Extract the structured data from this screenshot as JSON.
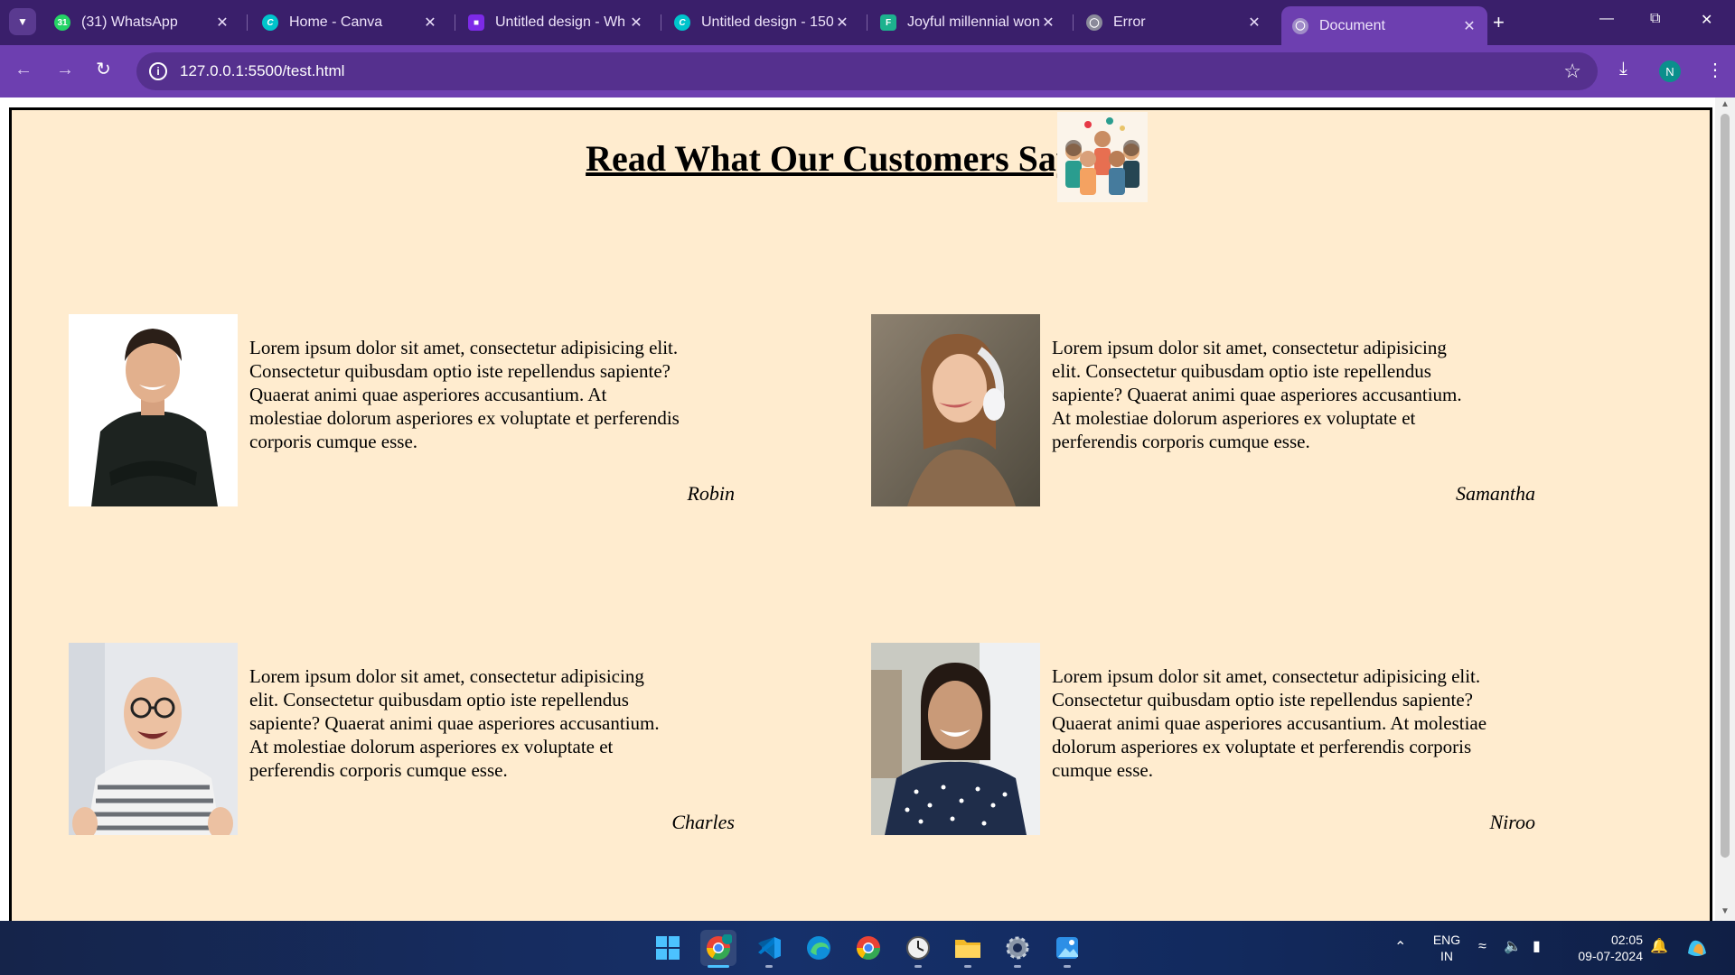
{
  "browser": {
    "tabs": [
      {
        "title": "(31) WhatsApp",
        "icon": "whatsapp-icon",
        "color": "#25d366"
      },
      {
        "title": "Home - Canva",
        "icon": "canva-icon",
        "color": "#00c4cc"
      },
      {
        "title": "Untitled design - Wh",
        "icon": "canva-design-icon",
        "color": "#7d2ae8"
      },
      {
        "title": "Untitled design - 150",
        "icon": "canva-icon",
        "color": "#00c4cc"
      },
      {
        "title": "Joyful millennial won",
        "icon": "freepik-icon",
        "color": "#1db28e"
      },
      {
        "title": "Error",
        "icon": "globe-icon",
        "color": "#8a8a9a"
      },
      {
        "title": "Document",
        "icon": "globe-icon",
        "color": "#a08cc8"
      }
    ],
    "active_tab_index": 6,
    "address": "127.0.0.1:5500/test.html",
    "profile_initial": "N",
    "accent": "#6d3fb0"
  },
  "page": {
    "heading": "Read What Our Customers Say",
    "testimonials": [
      {
        "name": "Robin",
        "text": "Lorem ipsum dolor sit amet, consectetur adipisicing elit. Consectetur quibusdam optio iste repellendus sapiente? Quaerat animi quae asperiores accusantium. At molestiae dolorum asperiores ex voluptate et perferendis corporis cumque esse."
      },
      {
        "name": "Samantha",
        "text": "Lorem ipsum dolor sit amet, consectetur adipisicing elit. Consectetur quibusdam optio iste repellendus sapiente? Quaerat animi quae asperiores accusantium. At molestiae dolorum asperiores ex voluptate et perferendis corporis cumque esse."
      },
      {
        "name": "Charles",
        "text": "Lorem ipsum dolor sit amet, consectetur adipisicing elit. Consectetur quibusdam optio iste repellendus sapiente? Quaerat animi quae asperiores accusantium. At molestiae dolorum asperiores ex voluptate et perferendis corporis cumque esse."
      },
      {
        "name": "Niroo",
        "text": "Lorem ipsum dolor sit amet, consectetur adipisicing elit. Consectetur quibusdam optio iste repellendus sapiente? Quaerat animi quae asperiores accusantium. At molestiae dolorum asperiores ex voluptate et perferendis corporis cumque esse."
      }
    ],
    "background": "#ffeccf"
  },
  "taskbar": {
    "apps": [
      "windows-start-icon",
      "chrome-profile-icon",
      "vscode-icon",
      "edge-icon",
      "chrome-icon",
      "clock-app-icon",
      "file-explorer-icon",
      "settings-icon",
      "photos-icon"
    ],
    "language": "ENG",
    "region": "IN",
    "time": "02:05",
    "date": "09-07-2024"
  }
}
